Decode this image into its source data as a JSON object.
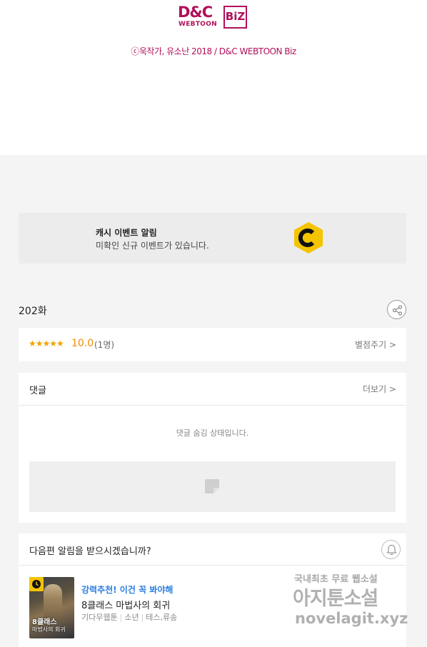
{
  "brand": {
    "logo_main": "D&C",
    "logo_sub": "WEBTOON",
    "logo_badge": "BiZ",
    "copyright": "ⓒ욱작가, 유소난 2018 / D&C WEBTOON Biz",
    "color": "#b0105a"
  },
  "cash_event": {
    "title": "캐시 이벤트 알림",
    "subtitle": "미확인 신규 이벤트가 있습니다.",
    "icon": "cash-c-icon",
    "icon_color": "#f4c400"
  },
  "episode": {
    "title": "202화",
    "share_icon": "share-icon"
  },
  "rating": {
    "stars": "★★★★★",
    "score": "10.0",
    "count": "(1명)",
    "rate_link": "별점주기 >"
  },
  "comments": {
    "label": "댓글",
    "more": "더보기 >",
    "hidden_message": "댓글 숨김 상태입니다."
  },
  "next_alert": {
    "question": "다음편 알림을 받으시겠습니까?",
    "bell_icon": "bell-icon"
  },
  "recommendation": {
    "tag": "강력추천! 이건 꼭 봐야해",
    "title": "8클래스 마법사의 회귀",
    "thumb_title_1": "8클래스",
    "thumb_title_2": "마법사의 회귀",
    "meta": [
      "기다무웹툰",
      "소년",
      "테스,류송"
    ],
    "badge_icon": "clock-icon"
  },
  "watermark": {
    "line1": "국내최초 무료 웹소설",
    "line2": "아지툰소설",
    "line3": "novelagit.xyz"
  }
}
